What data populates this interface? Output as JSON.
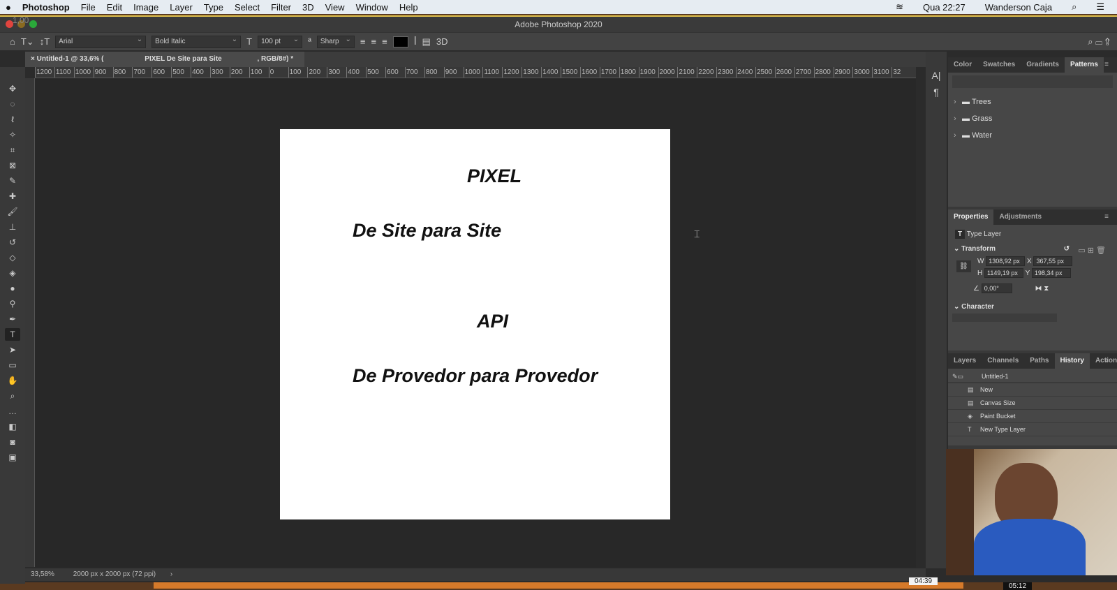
{
  "menubar": {
    "app": "Photoshop",
    "items": [
      "File",
      "Edit",
      "Image",
      "Layer",
      "Type",
      "Select",
      "Filter",
      "3D",
      "View",
      "Window",
      "Help"
    ],
    "clock": "Qua 22:27",
    "user": "Wanderson Caja"
  },
  "window": {
    "title": "Adobe Photoshop 2020",
    "overlay": "1,00"
  },
  "options": {
    "font": "Arial",
    "style": "Bold Italic",
    "size": "100 pt",
    "antialias": "Sharp",
    "color": "#000000",
    "threed": "3D"
  },
  "document": {
    "tab_left": "Untitled-1 @ 33,6% (",
    "tab_mid": "PIXEL   De Site para Site",
    "tab_right": ", RGB/8#) *"
  },
  "ruler": [
    "1200",
    "1100",
    "1000",
    "900",
    "800",
    "700",
    "600",
    "500",
    "400",
    "300",
    "200",
    "100",
    "0",
    "100",
    "200",
    "300",
    "400",
    "500",
    "600",
    "700",
    "800",
    "900",
    "1000",
    "1100",
    "1200",
    "1300",
    "1400",
    "1500",
    "1600",
    "1700",
    "1800",
    "1900",
    "2000",
    "2100",
    "2200",
    "2300",
    "2400",
    "2500",
    "2600",
    "2700",
    "2800",
    "2900",
    "3000",
    "3100",
    "32"
  ],
  "canvas": {
    "lines": [
      "PIXEL",
      "De Site para Site",
      "API",
      "De Provedor para Provedor"
    ]
  },
  "status": {
    "zoom": "33,58%",
    "size": "2000 px x 2000 px (72 ppi)"
  },
  "patterns": {
    "tabs": [
      "Color",
      "Swatches",
      "Gradients",
      "Patterns"
    ],
    "items": [
      "Trees",
      "Grass",
      "Water"
    ]
  },
  "properties": {
    "tabs": [
      "Properties",
      "Adjustments"
    ],
    "layer_type": "Type Layer",
    "transform": "Transform",
    "w_label": "W",
    "w": "1308,92 px",
    "x_label": "X",
    "x": "367,55 px",
    "h_label": "H",
    "h": "1149,19 px",
    "y_label": "Y",
    "y": "198,34 px",
    "angle": "0,00°",
    "character": "Character"
  },
  "history": {
    "tabs": [
      "Layers",
      "Channels",
      "Paths",
      "History",
      "Actions"
    ],
    "snapshot": "Untitled-1",
    "items": [
      "New",
      "Canvas Size",
      "Paint Bucket",
      "New Type Layer"
    ]
  },
  "dock": {
    "time1": "04:39",
    "time2": "05:12"
  }
}
